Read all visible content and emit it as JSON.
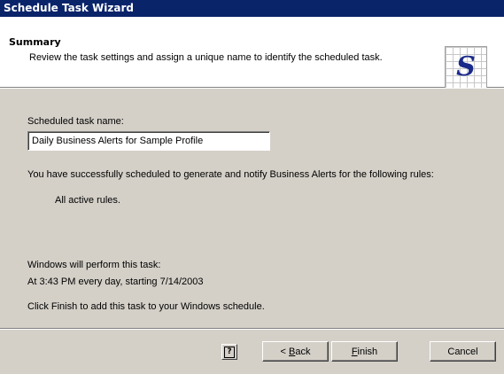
{
  "window": {
    "title": "Schedule Task Wizard"
  },
  "header": {
    "title": "Summary",
    "subtitle": "Review the task settings and assign a unique name to identify the scheduled task.",
    "logo_letter": "S"
  },
  "form": {
    "task_name_label": "Scheduled task name:",
    "task_name_value": "Daily Business Alerts for Sample Profile"
  },
  "summary": {
    "success_text": "You have successfully scheduled to generate and notify Business Alerts for the following rules:",
    "rules_text": "All active rules.",
    "perform_label": "Windows will perform this task:",
    "schedule_text": "At 3:43 PM every day, starting 7/14/2003",
    "finish_hint": "Click Finish to add this task to your Windows schedule."
  },
  "buttons": {
    "help_glyph": "?",
    "back_prefix": "< ",
    "back_mnemonic": "B",
    "back_rest": "ack",
    "finish_mnemonic": "F",
    "finish_rest": "inish",
    "cancel_label": "Cancel"
  }
}
